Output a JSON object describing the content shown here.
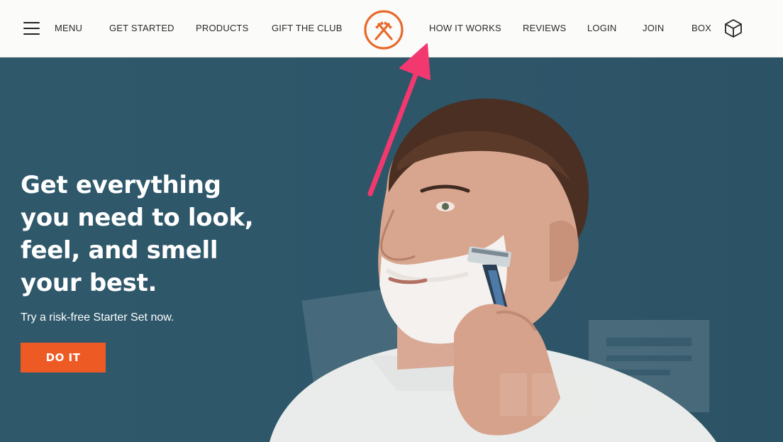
{
  "nav": {
    "menu_label": "MENU",
    "items": [
      "GET STARTED",
      "PRODUCTS",
      "GIFT THE CLUB",
      "HOW IT WORKS",
      "REVIEWS",
      "LOGIN",
      "JOIN",
      "BOX"
    ],
    "icons": {
      "menu": "hamburger-icon",
      "logo": "crossed-hammers-logo",
      "box": "cube-box-icon"
    }
  },
  "hero": {
    "headline": "Get everything you need to look, feel, and smell your best.",
    "subtext": "Try a risk-free Starter Set now.",
    "cta_label": "DO IT"
  },
  "colors": {
    "nav_bg": "#fbfbf9",
    "hero_bg": "#2e5568",
    "brand_orange": "#ee5a24",
    "logo_orange": "#e86a2a",
    "annotation_arrow": "#f2386f"
  }
}
